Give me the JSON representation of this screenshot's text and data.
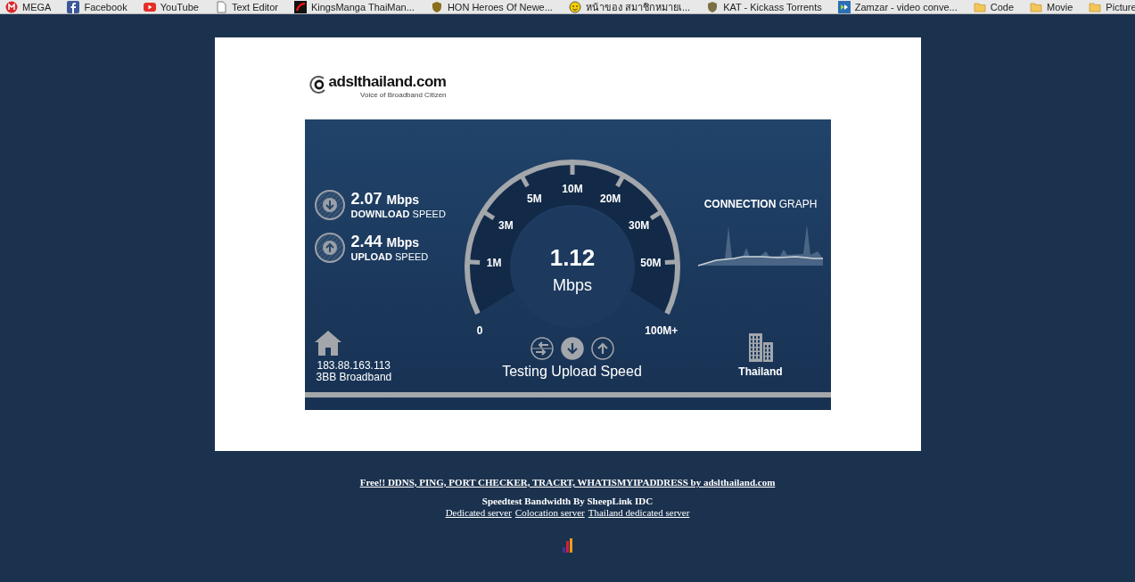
{
  "bookmarks": [
    {
      "label": "MEGA",
      "kind": "mega"
    },
    {
      "label": "Facebook",
      "kind": "facebook"
    },
    {
      "label": "YouTube",
      "kind": "youtube"
    },
    {
      "label": "Text Editor",
      "kind": "page"
    },
    {
      "label": "KingsManga ThaiMan...",
      "kind": "manga"
    },
    {
      "label": "HON Heroes Of Newe...",
      "kind": "hon"
    },
    {
      "label": "หน้าของ สมาชิกหมายเ...",
      "kind": "smiley"
    },
    {
      "label": "KAT - Kickass Torrents",
      "kind": "kat"
    },
    {
      "label": "Zamzar - video conve...",
      "kind": "zamzar"
    },
    {
      "label": "Code",
      "kind": "folder"
    },
    {
      "label": "Movie",
      "kind": "folder"
    },
    {
      "label": "Picture",
      "kind": "folder"
    }
  ],
  "logo": {
    "name": "adslthailand.com",
    "tagline": "Voice of Broadband Citizen"
  },
  "speedtest": {
    "download": {
      "value": "2.07",
      "unit": "Mbps",
      "label_bold": "DOWNLOAD",
      "label": "SPEED"
    },
    "upload": {
      "value": "2.44",
      "unit": "Mbps",
      "label_bold": "UPLOAD",
      "label": "SPEED"
    },
    "gauge": {
      "reading": "1.12",
      "unit": "Mbps",
      "ticks": [
        "0",
        "1M",
        "3M",
        "5M",
        "10M",
        "20M",
        "30M",
        "50M",
        "100M+"
      ]
    },
    "graph_title_bold": "CONNECTION",
    "graph_title": "GRAPH",
    "client": {
      "ip": "183.88.163.113",
      "isp": "3BB Broadband"
    },
    "modes": [
      {
        "kind": "ping",
        "selected": false
      },
      {
        "kind": "download",
        "selected": true
      },
      {
        "kind": "upload",
        "selected": false
      }
    ],
    "status": "Testing Upload Speed",
    "server": "Thailand"
  },
  "footer": {
    "tools_link": "Free!! DDNS, PING, PORT CHECKER, TRACRT, WHATISMYIPADDRESS by adslthailand.com",
    "credit": "Speedtest Bandwidth By SheepLink IDC",
    "links": [
      "Dedicated server",
      "Colocation server",
      "Thailand dedicated server"
    ]
  }
}
